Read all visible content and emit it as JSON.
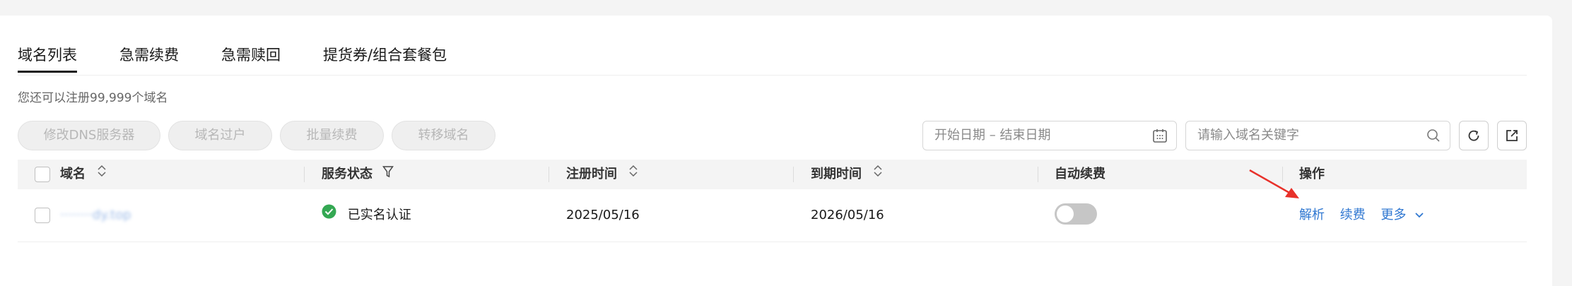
{
  "tabs": [
    {
      "label": "域名列表",
      "active": true
    },
    {
      "label": "急需续费",
      "active": false
    },
    {
      "label": "急需赎回",
      "active": false
    },
    {
      "label": "提货券/组合套餐包",
      "active": false
    }
  ],
  "quota_text": "您还可以注册99,999个域名",
  "toolbar": {
    "buttons": [
      "修改DNS服务器",
      "域名过户",
      "批量续费",
      "转移域名"
    ],
    "date_range_placeholder": "开始日期 – 结束日期",
    "search_placeholder": "请输入域名关键字",
    "icons": [
      "calendar-icon",
      "search-icon",
      "refresh-icon",
      "export-icon"
    ]
  },
  "table": {
    "columns": [
      "域名",
      "服务状态",
      "注册时间",
      "到期时间",
      "自动续费",
      "操作"
    ],
    "rows": [
      {
        "domain": "········dy.top",
        "status": "已实名认证",
        "registered": "2025/05/16",
        "expires": "2026/05/16",
        "auto_renew": false,
        "actions": [
          "解析",
          "续费",
          "更多"
        ]
      }
    ]
  },
  "colors": {
    "link": "#2f77d1",
    "status_ok": "#34a853",
    "annotation_arrow": "#e8312a"
  }
}
